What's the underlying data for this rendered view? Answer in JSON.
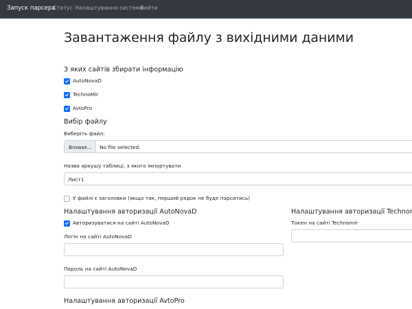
{
  "nav": {
    "brand": "Запуск парсера",
    "links": [
      "Статус",
      "Налаштування системи",
      "Вийти"
    ]
  },
  "page": {
    "title": "Завантаження файлу з вихідними даними"
  },
  "sites": {
    "heading": "З яких сайтів збирати інформацію",
    "items": [
      {
        "label": "AutoNovaD",
        "checked": true
      },
      {
        "label": "TechnoMir",
        "checked": true
      },
      {
        "label": "AvtoPro",
        "checked": true
      }
    ]
  },
  "file": {
    "heading": "Вибір файлу",
    "label": "Виберіть файл:",
    "button": "Browse...",
    "status": "No file selected."
  },
  "sheet": {
    "label": "Назва аркушу таблиці, з якого імпортувати",
    "value": "Лист1"
  },
  "headers_checkbox": {
    "label": "У файлі є заголовки (якщо так, перший рядок не буде парситись)",
    "checked": false
  },
  "autonovad": {
    "heading": "Налаштування авторизації AutoNovaD",
    "auth_label": "Авторизуватися на сайті AutoNovaD",
    "login_label": "Логін на сайті AutoNovaD",
    "login_value": "",
    "password_label": "Пароль на сайті AutoNovaD",
    "password_value": ""
  },
  "technomir": {
    "heading": "Налаштування авторизації Technomir",
    "token_label": "Токен на сайті Technomir",
    "token_value": ""
  },
  "avtopro": {
    "heading": "Налаштування авторизації AvtoPro"
  },
  "colors": {
    "navbar": "#343a40",
    "primary": "#0d6efd",
    "border": "#ced4da"
  }
}
